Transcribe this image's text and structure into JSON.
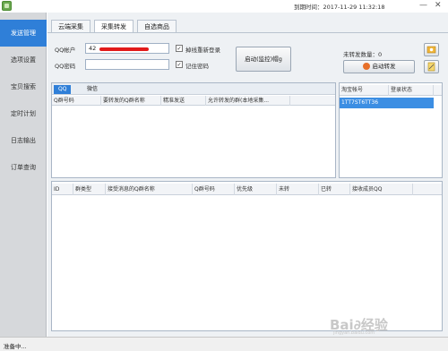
{
  "titlebar": {
    "expire_text": "到期时间：2017-11-29 11:32:18",
    "minimize": "—",
    "close": "✕"
  },
  "sidebar": {
    "items": [
      "发送管理",
      "选项设置",
      "宝贝搜索",
      "定时计划",
      "日志输出",
      "订单查询"
    ]
  },
  "tabs": [
    "云端采集",
    "采集转发",
    "自选商品"
  ],
  "qq": {
    "account_label": "QQ帐户",
    "account_value": "42",
    "password_label": "QQ密码",
    "password_value": "",
    "relogin_label": "掉线重新登录",
    "remember_label": "记住密码",
    "start_monitor_button": "启动(监控)帽g"
  },
  "forward": {
    "count_label": "未转发数量：0",
    "start_forward_button": "启动转发"
  },
  "left_grid": {
    "subtabs": [
      "QQ",
      "微信"
    ],
    "headers": [
      "Q群号码",
      "要转发的Q群名称",
      "精准发送",
      "允许转发的群(本地采集..."
    ]
  },
  "taobao_grid": {
    "headers": [
      "淘宝帐号",
      "登录状态"
    ],
    "rows": [
      [
        "1TT7ST6TT36",
        ""
      ]
    ]
  },
  "bottom_grid": {
    "headers": [
      "ID",
      "群类型",
      "接受消息的Q群名称",
      "Q群号码",
      "优先级",
      "未转",
      "已转",
      "接收成员QQ"
    ]
  },
  "status": {
    "text": "准备中..."
  },
  "watermark": {
    "text": "Bai∂经验",
    "sub": "jingyan.baidu.com"
  },
  "colors": {
    "accent": "#2f7fd8",
    "redact": "#e21b1b"
  },
  "icons": {
    "refresh": "refresh-icon",
    "play": "play-icon",
    "edit": "edit-icon"
  }
}
